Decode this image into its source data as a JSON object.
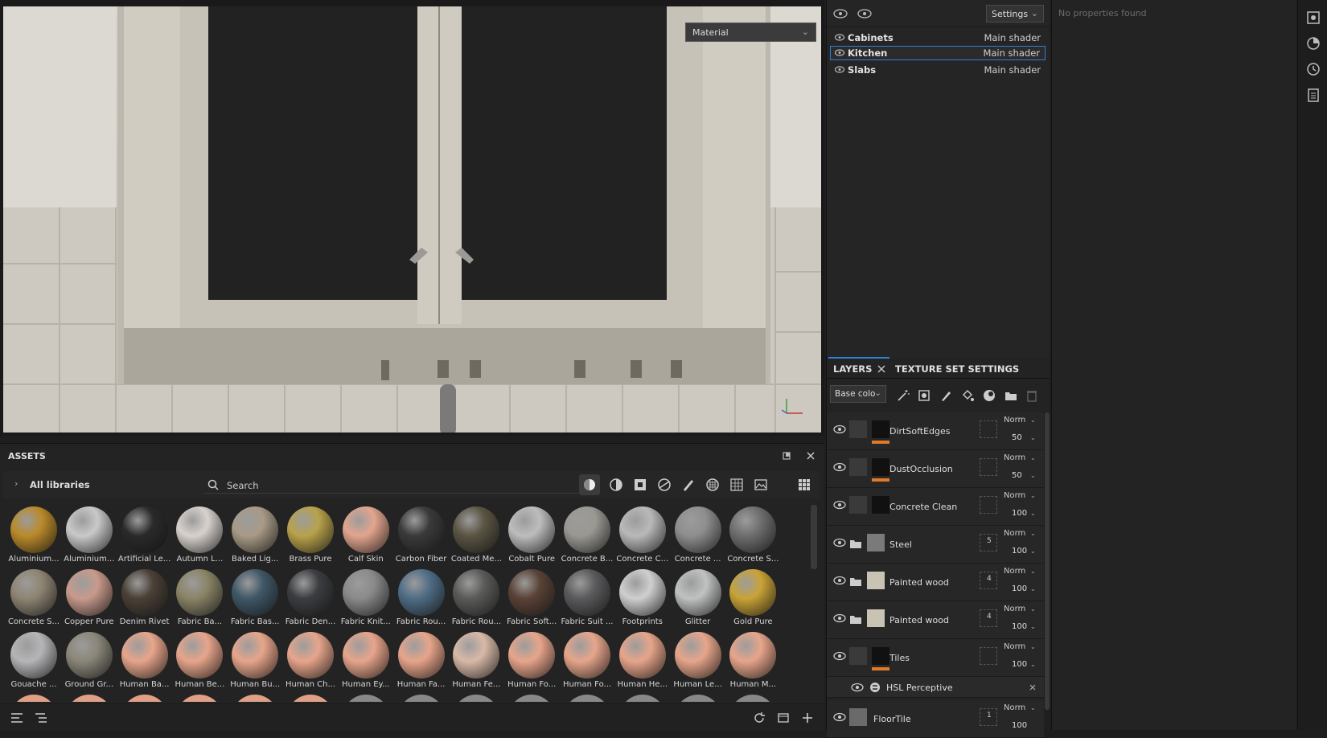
{
  "viewport": {
    "material_dropdown": "Material"
  },
  "outliner": {
    "settings_label": "Settings",
    "texture_sets": [
      {
        "name": "Cabinets",
        "shader": "Main shader"
      },
      {
        "name": "Kitchen",
        "shader": "Main shader"
      },
      {
        "name": "Slabs",
        "shader": "Main shader"
      }
    ],
    "selected": "Kitchen"
  },
  "properties": {
    "empty_text": "No properties found"
  },
  "assets": {
    "title": "ASSETS",
    "library": "All libraries",
    "search_placeholder": "Search",
    "materials": [
      {
        "label": "Aluminium...",
        "color": "#b98a2a"
      },
      {
        "label": "Aluminium...",
        "color": "#c9c9c9"
      },
      {
        "label": "Artificial Le...",
        "color": "#2a2a2a"
      },
      {
        "label": "Autumn L...",
        "color": "#d8d2cc"
      },
      {
        "label": "Baked Lig...",
        "color": "#a89a86"
      },
      {
        "label": "Brass Pure",
        "color": "#b8a24a"
      },
      {
        "label": "Calf Skin",
        "color": "#e2a58e"
      },
      {
        "label": "Carbon Fiber",
        "color": "#3a3a3a"
      },
      {
        "label": "Coated Me...",
        "color": "#5a5443"
      },
      {
        "label": "Cobalt Pure",
        "color": "#bdbdbd"
      },
      {
        "label": "Concrete B...",
        "color": "#9a9892"
      },
      {
        "label": "Concrete C...",
        "color": "#b9b9b9"
      },
      {
        "label": "Concrete ...",
        "color": "#8e8e8e"
      },
      {
        "label": "Concrete S...",
        "color": "#6e6e6e"
      },
      {
        "label": "Concrete S...",
        "color": "#8e8472"
      },
      {
        "label": "Copper Pure",
        "color": "#c89a8c"
      },
      {
        "label": "Denim Rivet",
        "color": "#4a4036"
      },
      {
        "label": "Fabric Ba...",
        "color": "#8a8466"
      },
      {
        "label": "Fabric Bas...",
        "color": "#3f5766"
      },
      {
        "label": "Fabric Den...",
        "color": "#3b3d40"
      },
      {
        "label": "Fabric Knit...",
        "color": "#8a8a8a"
      },
      {
        "label": "Fabric Rou...",
        "color": "#4f6d86"
      },
      {
        "label": "Fabric Rou...",
        "color": "#5a5a58"
      },
      {
        "label": "Fabric Soft...",
        "color": "#5a4236"
      },
      {
        "label": "Fabric Suit ...",
        "color": "#5a5a5c"
      },
      {
        "label": "Footprints",
        "color": "#cfcfcf"
      },
      {
        "label": "Glitter",
        "color": "#bfc2c0"
      },
      {
        "label": "Gold Pure",
        "color": "#c9a336"
      },
      {
        "label": "Gouache ...",
        "color": "#b5b5b8"
      },
      {
        "label": "Ground Gr...",
        "color": "#8a8679"
      },
      {
        "label": "Human Ba...",
        "color": "#e7a58b"
      },
      {
        "label": "Human Be...",
        "color": "#e7a58b"
      },
      {
        "label": "Human Bu...",
        "color": "#e7a58b"
      },
      {
        "label": "Human Ch...",
        "color": "#e7a58b"
      },
      {
        "label": "Human Ey...",
        "color": "#e7a58b"
      },
      {
        "label": "Human Fa...",
        "color": "#e7a58b"
      },
      {
        "label": "Human Fe...",
        "color": "#d9b9a8"
      },
      {
        "label": "Human Fo...",
        "color": "#e7a58b"
      },
      {
        "label": "Human Fo...",
        "color": "#e7a58b"
      },
      {
        "label": "Human He...",
        "color": "#e7a58b"
      },
      {
        "label": "Human Le...",
        "color": "#e7a58b"
      },
      {
        "label": "Human M...",
        "color": "#e7a58b"
      }
    ]
  },
  "layers_panel": {
    "tab_layers": "LAYERS",
    "tab_texture_set": "TEXTURE SET SETTINGS",
    "channel": "Base colo",
    "layers": [
      {
        "name": "DirtSoftEdges",
        "blend": "Norm",
        "opacity": "50",
        "type": "fill",
        "count": "",
        "bar": "#e07a2a"
      },
      {
        "name": "DustOcclusion",
        "blend": "Norm",
        "opacity": "50",
        "type": "fill",
        "count": "",
        "bar": "#e07a2a"
      },
      {
        "name": "Concrete Clean",
        "blend": "Norm",
        "opacity": "100",
        "type": "fill",
        "count": "",
        "bar": ""
      },
      {
        "name": "Steel",
        "blend": "Norm",
        "opacity": "100",
        "type": "folder",
        "count": "5",
        "bar": ""
      },
      {
        "name": "Painted wood",
        "blend": "Norm",
        "opacity": "100",
        "type": "folder",
        "count": "4",
        "bar": ""
      },
      {
        "name": "Painted wood",
        "blend": "Norm",
        "opacity": "100",
        "type": "folder",
        "count": "4",
        "bar": ""
      },
      {
        "name": "Tiles",
        "blend": "Norm",
        "opacity": "100",
        "type": "fill",
        "count": "",
        "bar": "#e07a2a"
      }
    ],
    "filter": {
      "name": "HSL Perceptive"
    },
    "last_layer": {
      "name": "FloorTile",
      "blend": "Norm",
      "opacity": "100",
      "count": "1"
    }
  },
  "colors": {
    "accent": "#2f7fd8",
    "orange": "#e07a2a"
  }
}
